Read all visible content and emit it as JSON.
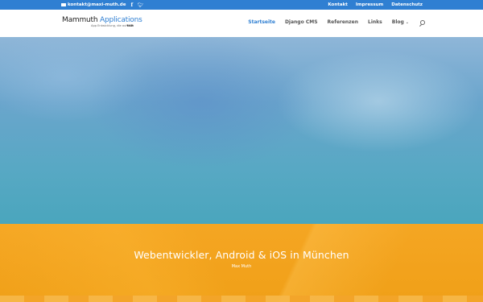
{
  "topbar": {
    "email": "kontakt@maxi-muth.de",
    "links": [
      "Kontakt",
      "Impressum",
      "Datenschutz"
    ]
  },
  "header": {
    "logo_word1": "Mammuth",
    "logo_word2": "Applications",
    "logo_tagline_pre": "App Entwicklung, die auf",
    "logo_tagline_bold": "fällt",
    "nav": [
      {
        "label": "Startseite",
        "active": true
      },
      {
        "label": "Django CMS",
        "active": false
      },
      {
        "label": "Referenzen",
        "active": false
      },
      {
        "label": "Links",
        "active": false
      },
      {
        "label": "Blog",
        "active": false
      }
    ]
  },
  "hero": {
    "title": "Webentwickler, Android & iOS in München",
    "subtitle": "Max Muth"
  },
  "colors": {
    "accent": "#2f7fd2",
    "orange": "#f5a623"
  },
  "icons": [
    "mail-icon",
    "facebook-icon",
    "twitter-icon",
    "chevron-down-icon",
    "search-icon"
  ]
}
